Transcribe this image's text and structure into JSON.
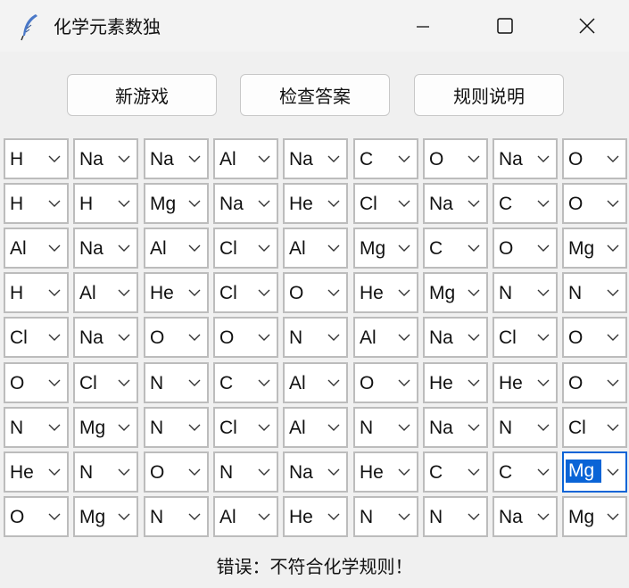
{
  "window": {
    "title": "化学元素数独",
    "minimize_icon": "minimize-icon",
    "maximize_icon": "maximize-icon",
    "close_icon": "close-icon",
    "app_icon": "feather-icon"
  },
  "toolbar": {
    "new_game_label": "新游戏",
    "check_answer_label": "检查答案",
    "rules_label": "规则说明"
  },
  "grid": {
    "selected": [
      7,
      8
    ],
    "rows": [
      [
        "H",
        "Na",
        "Na",
        "Al",
        "Na",
        "C",
        "O",
        "Na",
        "O"
      ],
      [
        "H",
        "H",
        "Mg",
        "Na",
        "He",
        "Cl",
        "Na",
        "C",
        "O"
      ],
      [
        "Al",
        "Na",
        "Al",
        "Cl",
        "Al",
        "Mg",
        "C",
        "O",
        "Mg"
      ],
      [
        "H",
        "Al",
        "He",
        "Cl",
        "O",
        "He",
        "Mg",
        "N",
        "N"
      ],
      [
        "Cl",
        "Na",
        "O",
        "O",
        "N",
        "Al",
        "Na",
        "Cl",
        "O"
      ],
      [
        "O",
        "Cl",
        "N",
        "C",
        "Al",
        "O",
        "He",
        "He",
        "O"
      ],
      [
        "N",
        "Mg",
        "N",
        "Cl",
        "Al",
        "N",
        "Na",
        "N",
        "Cl"
      ],
      [
        "He",
        "N",
        "O",
        "N",
        "Na",
        "He",
        "C",
        "C",
        "Mg"
      ],
      [
        "O",
        "Mg",
        "N",
        "Al",
        "He",
        "N",
        "N",
        "Na",
        "Mg"
      ]
    ]
  },
  "status": {
    "text": "错误：不符合化学规则！"
  },
  "colors": {
    "selection": "#0a64d6",
    "cell_border": "#bcbcbc",
    "background": "#f0f0f0"
  }
}
